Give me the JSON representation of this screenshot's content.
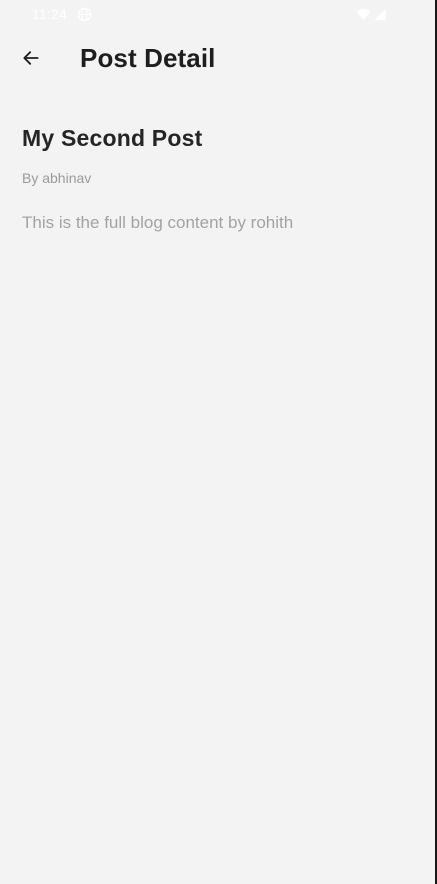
{
  "status_bar": {
    "time": "11:24",
    "globe_icon": "globe-icon",
    "wifi_icon": "wifi-icon",
    "signal_icon": "signal-icon"
  },
  "app_bar": {
    "back_icon": "arrow-left-icon",
    "title": "Post Detail"
  },
  "post": {
    "title": "My Second Post",
    "author": "By abhinav",
    "content": "This is the full blog content by rohith"
  },
  "colors": {
    "background": "#f3f3f3",
    "title_text": "#1e1e1e",
    "muted_text": "#9a9a9a"
  }
}
